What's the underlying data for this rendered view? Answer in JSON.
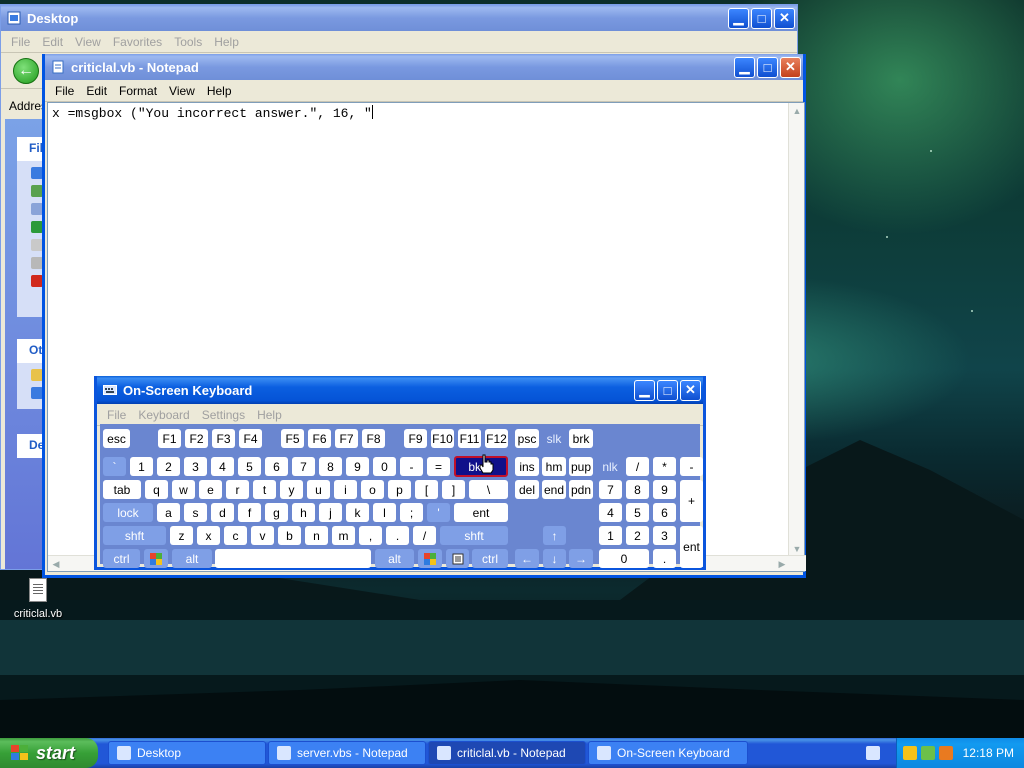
{
  "explorer": {
    "title": "Desktop",
    "menu": [
      "File",
      "Edit",
      "View",
      "Favorites",
      "Tools",
      "Help"
    ],
    "address_label": "Address",
    "side_headers": [
      "File",
      "Ot",
      "De"
    ]
  },
  "notepad": {
    "title": "criticlal.vb - Notepad",
    "menu": [
      "File",
      "Edit",
      "Format",
      "View",
      "Help"
    ],
    "content": "x =msgbox (\"You incorrect answer.\", 16, \""
  },
  "osk": {
    "title": "On-Screen Keyboard",
    "menu": [
      "File",
      "Keyboard",
      "Settings",
      "Help"
    ],
    "keys": {
      "esc": "esc",
      "f1": "F1",
      "f2": "F2",
      "f3": "F3",
      "f4": "F4",
      "f5": "F5",
      "f6": "F6",
      "f7": "F7",
      "f8": "F8",
      "f9": "F9",
      "f10": "F10",
      "f11": "F11",
      "f12": "F12",
      "psc": "psc",
      "slk": "slk",
      "brk": "brk",
      "grave": "`",
      "k1": "1",
      "k2": "2",
      "k3": "3",
      "k4": "4",
      "k5": "5",
      "k6": "6",
      "k7": "7",
      "k8": "8",
      "k9": "9",
      "k0": "0",
      "minus": "-",
      "equals": "=",
      "bksp": "bksp",
      "ins": "ins",
      "hm": "hm",
      "pup": "pup",
      "nlk": "nlk",
      "slash_np": "/",
      "star_np": "*",
      "minus_np": "-",
      "tab": "tab",
      "q": "q",
      "w": "w",
      "e": "e",
      "r": "r",
      "t": "t",
      "y": "y",
      "u": "u",
      "i": "i",
      "o": "o",
      "p": "p",
      "lbracket": "[",
      "rbracket": "]",
      "backslash": "\\",
      "del": "del",
      "end": "end",
      "pdn": "pdn",
      "np7": "7",
      "np8": "8",
      "np9": "9",
      "plus_np": "+",
      "lock": "lock",
      "a": "a",
      "s": "s",
      "d": "d",
      "f": "f",
      "g": "g",
      "h": "h",
      "j": "j",
      "k": "k",
      "l": "l",
      "semicolon": ";",
      "quote": "'",
      "ent": "ent",
      "np4": "4",
      "np5": "5",
      "np6": "6",
      "shft_l": "shft",
      "z": "z",
      "x": "x",
      "c": "c",
      "v": "v",
      "b": "b",
      "n": "n",
      "m": "m",
      "comma": ",",
      "period": ".",
      "slash": "/",
      "shft_r": "shft",
      "up": "↑",
      "np1": "1",
      "np2": "2",
      "np3": "3",
      "ent_np": "ent",
      "ctrl_l": "ctrl",
      "alt_l": "alt",
      "alt_r": "alt",
      "ctrl_r": "ctrl",
      "left": "←",
      "down": "↓",
      "right": "→",
      "np0": "0",
      "npdot": "."
    }
  },
  "desktop_icon": {
    "label": "criticlal.vb"
  },
  "taskbar": {
    "start": "start",
    "items": [
      "Desktop",
      "server.vbs - Notepad",
      "criticlal.vb - Notepad",
      "On-Screen Keyboard"
    ],
    "clock": "12:18 PM"
  },
  "colors": {
    "xp_blue": "#0054e3",
    "taskbar_blue": "#2157d7",
    "start_green": "#37a037",
    "osk_key_bg": "#6a86d0"
  }
}
